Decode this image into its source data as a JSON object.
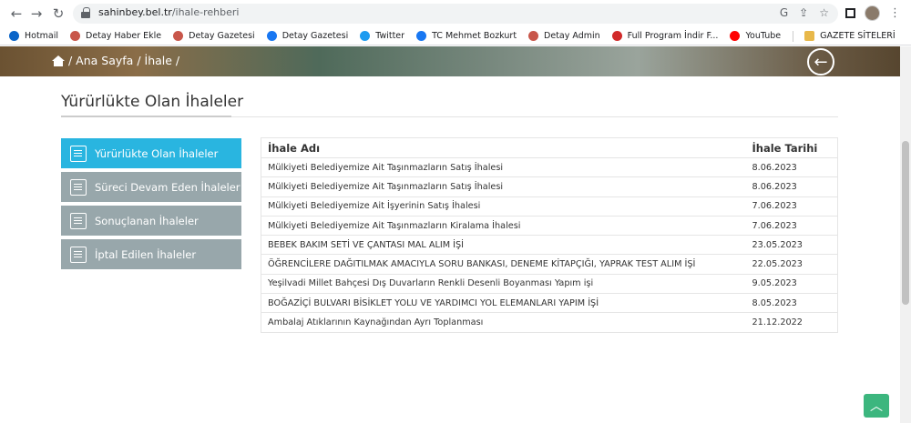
{
  "browser": {
    "url_host": "sahinbey.bel.tr",
    "url_path": "/ihale-rehberi",
    "bookmarks": [
      {
        "label": "Hotmail",
        "icon": "outlook-icon",
        "color": "#0a64c8"
      },
      {
        "label": "Detay Haber Ekle",
        "icon": "site-icon",
        "color": "#c8564a"
      },
      {
        "label": "Detay Gazetesi",
        "icon": "site-icon",
        "color": "#c8564a"
      },
      {
        "label": "Detay Gazetesi",
        "icon": "facebook-icon",
        "color": "#1877f2"
      },
      {
        "label": "Twitter",
        "icon": "twitter-icon",
        "color": "#1d9bf0"
      },
      {
        "label": "TC Mehmet Bozkurt",
        "icon": "facebook-icon",
        "color": "#1877f2"
      },
      {
        "label": "Detay Admin",
        "icon": "site-icon",
        "color": "#c8564a"
      },
      {
        "label": "Full Program İndir F...",
        "icon": "site-icon",
        "color": "#d12a2a"
      },
      {
        "label": "YouTube",
        "icon": "youtube-icon",
        "color": "#ff0000"
      },
      {
        "label": "GAZETE SİTELERİ",
        "icon": "folder-icon",
        "color": "#e8b84a"
      }
    ]
  },
  "breadcrumb": " / Ana Sayfa / İhale /",
  "page_title": "Yürürlükte Olan İhaleler",
  "sidebar": {
    "items": [
      {
        "label": "Yürürlükte Olan İhaleler",
        "active": true
      },
      {
        "label": "Süreci Devam Eden İhaleler",
        "active": false
      },
      {
        "label": "Sonuçlanan İhaleler",
        "active": false
      },
      {
        "label": "İptal Edilen İhaleler",
        "active": false
      }
    ]
  },
  "table": {
    "headers": {
      "name": "İhale Adı",
      "date": "İhale Tarihi"
    },
    "rows": [
      {
        "name": "Mülkiyeti Belediyemize Ait Taşınmazların Satış İhalesi",
        "date": "8.06.2023"
      },
      {
        "name": "Mülkiyeti Belediyemize Ait Taşınmazların Satış İhalesi",
        "date": "8.06.2023"
      },
      {
        "name": "Mülkiyeti Belediyemize Ait İşyerinin Satış İhalesi",
        "date": "7.06.2023"
      },
      {
        "name": "Mülkiyeti Belediyemize Ait Taşınmazların Kiralama İhalesi",
        "date": "7.06.2023"
      },
      {
        "name": "BEBEK BAKIM SETİ VE ÇANTASI MAL ALIM İŞİ",
        "date": "23.05.2023"
      },
      {
        "name": "ÖĞRENCİLERE DAĞITILMAK AMACIYLA SORU BANKASI, DENEME KİTAPÇIĞI, YAPRAK TEST ALIM İŞİ",
        "date": "22.05.2023"
      },
      {
        "name": "Yeşilvadi Millet Bahçesi Dış Duvarların Renkli Desenli Boyanması Yapım işi",
        "date": "9.05.2023"
      },
      {
        "name": "BOĞAZİÇİ BULVARI BİSİKLET YOLU VE YARDIMCI YOL ELEMANLARI YAPIM İŞİ",
        "date": "8.05.2023"
      },
      {
        "name": "Ambalaj Atıklarının Kaynağından Ayrı Toplanması",
        "date": "21.12.2022"
      }
    ]
  }
}
